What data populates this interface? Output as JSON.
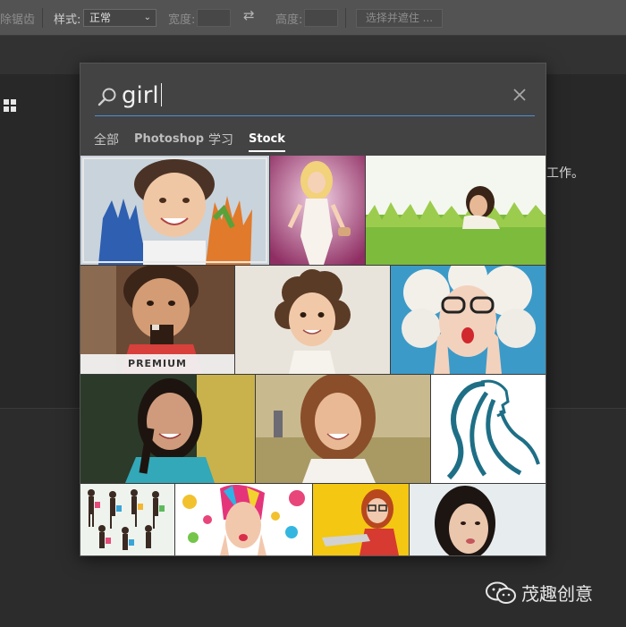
{
  "options_bar": {
    "antialias_partial": "除锯齿",
    "style_label": "样式:",
    "style_value": "正常",
    "width_label": "宽度:",
    "height_label": "高度:",
    "select_mask_button": "选择并遮住 ..."
  },
  "background": {
    "partial_text": "工作。"
  },
  "search": {
    "query": "girl"
  },
  "tabs": [
    {
      "label": "全部"
    },
    {
      "label": "Photoshop"
    },
    {
      "label": "学习"
    },
    {
      "label": "Stock",
      "active": true
    }
  ],
  "results": {
    "premium_badge": "PREMIUM",
    "tiles": [
      {
        "subject": "child-painted-hands",
        "selected": true
      },
      {
        "subject": "cartoon-fashion-girl"
      },
      {
        "subject": "woman-lying-in-grass"
      },
      {
        "subject": "girl-eating-chocolate",
        "premium": true
      },
      {
        "subject": "curly-hair-girl"
      },
      {
        "subject": "surprised-woman-glasses"
      },
      {
        "subject": "smiling-woman-braid"
      },
      {
        "subject": "smiling-woman-field"
      },
      {
        "subject": "woman-hair-illustration"
      },
      {
        "subject": "shopping-girls-silhouettes"
      },
      {
        "subject": "colorful-makeup-woman"
      },
      {
        "subject": "redhead-with-laptop"
      },
      {
        "subject": "asian-girl-portrait"
      }
    ]
  },
  "watermark": {
    "text": "茂趣创意"
  },
  "colors": {
    "accent_underline": "#4e8ed8",
    "panel_bg": "#434343"
  }
}
